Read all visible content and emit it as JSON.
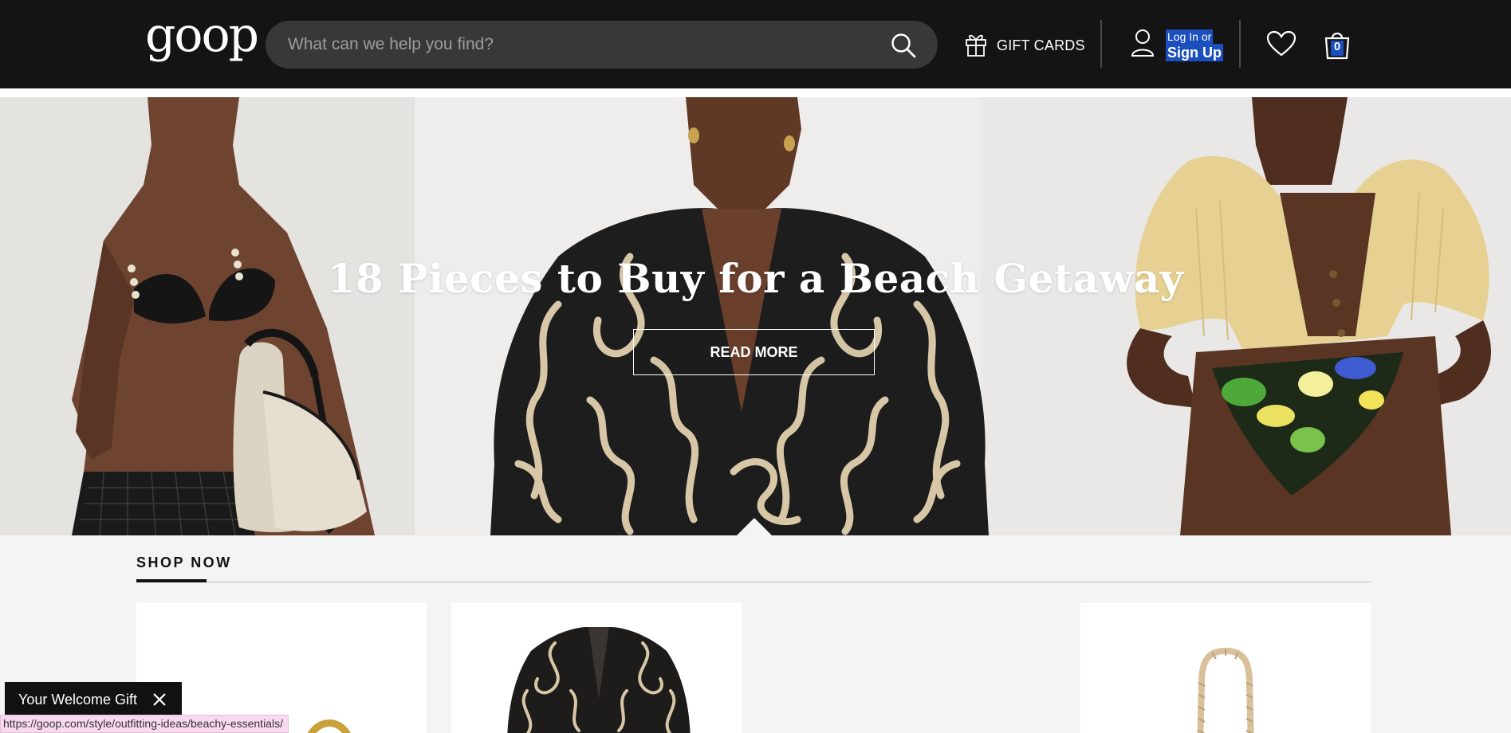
{
  "header": {
    "logo": "goop",
    "search_placeholder": "What can we help you find?",
    "gift_cards_label": "GIFT CARDS",
    "login_label": "Log In or",
    "signup_label": "Sign Up",
    "cart_count": "0",
    "icons": [
      "search-icon",
      "gift-icon",
      "user-icon",
      "heart-icon",
      "bag-icon"
    ]
  },
  "hero": {
    "title": "18 Pieces to Buy for a Beach Getaway",
    "button_label": "READ MORE"
  },
  "shop": {
    "title": "SHOP NOW"
  },
  "welcome": {
    "label": "Your Welcome Gift"
  },
  "status": {
    "url": "https://goop.com/style/outfitting-ideas/beachy-essentials/"
  },
  "colors": {
    "header_bg": "#141414",
    "search_bg": "#383838",
    "selection": "#1a4fbd",
    "page_bg": "#f4f4f4"
  }
}
